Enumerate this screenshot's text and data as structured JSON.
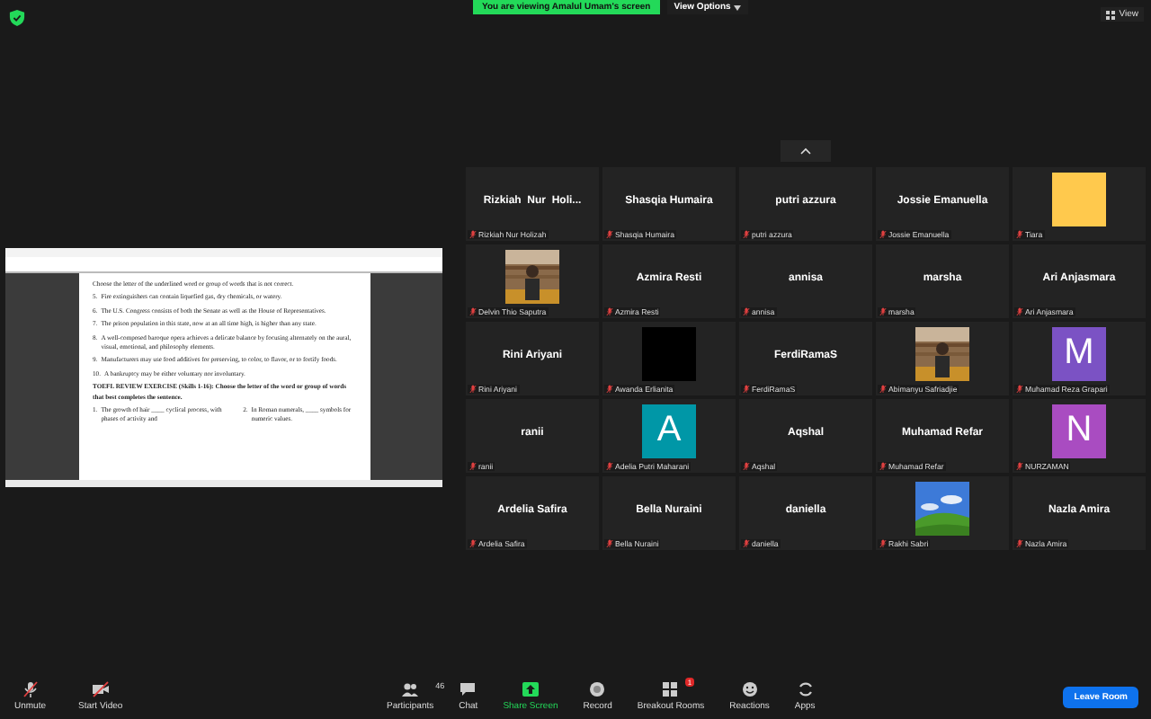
{
  "top_bar": {
    "banner": "You are viewing Amalul Umam's screen",
    "view_options": "View Options",
    "view": "View"
  },
  "shared_document": {
    "instruction": "Choose the letter of the underlined word or group of words that is not correct.",
    "items": [
      {
        "number": "5.",
        "text": "Fire extinguishers can contain liquefied gas, dry chemicals, or watery."
      },
      {
        "number": "6.",
        "text": "The U.S. Congress consists of both the Senate as well as the House of Representatives."
      },
      {
        "number": "7.",
        "text": "The prison population in this state, now at an all time high, is higher than any state."
      },
      {
        "number": "8.",
        "text": "A well-composed baroque opera achieves a delicate balance by focusing alternately on the aural, visual, emotional, and philosophy elements."
      },
      {
        "number": "9.",
        "text": "Manufacturers may use food additives for preserving, to color, to flavor, or to fortify foods."
      },
      {
        "number": "10.",
        "text": "A bankruptcy may be either voluntary nor involuntary."
      }
    ],
    "exercise": "TOEFL REVIEW EXERCISE (Skills 1-16): Choose the letter of the word or group of words that best completes the sentence.",
    "questions": [
      {
        "number": "1.",
        "text": "The growth of hair ____ cyclical process, with phases of activity and"
      },
      {
        "number": "2.",
        "text": "In Roman numerals, ____ symbols for numeric values."
      }
    ]
  },
  "gallery": [
    {
      "kind": "name",
      "title": "Rizkiah  Nur  Holi...",
      "name": "Rizkiah Nur Holizah"
    },
    {
      "kind": "name",
      "title": "Shasqia Humaira",
      "name": "Shasqia Humaira"
    },
    {
      "kind": "name",
      "title": "putri azzura",
      "name": "putri azzura"
    },
    {
      "kind": "name",
      "title": "Jossie Emanuella",
      "name": "Jossie Emanuella"
    },
    {
      "kind": "avatar",
      "color": "#ffc94d",
      "name": "Tiara"
    },
    {
      "kind": "picture",
      "name": "Delvin Thio Saputra"
    },
    {
      "kind": "name",
      "title": "Azmira Resti",
      "name": "Azmira Resti"
    },
    {
      "kind": "name",
      "title": "annisa",
      "name": "annisa"
    },
    {
      "kind": "name",
      "title": "marsha",
      "name": "marsha"
    },
    {
      "kind": "name",
      "title": "Ari Anjasmara",
      "name": "Ari Anjasmara"
    },
    {
      "kind": "name",
      "title": "Rini Ariyani",
      "name": "Rini Ariyani"
    },
    {
      "kind": "avatar",
      "color": "#000000",
      "name": "Awanda Erlianita"
    },
    {
      "kind": "name",
      "title": "FerdiRamaS",
      "name": "FerdiRamaS"
    },
    {
      "kind": "picture",
      "name": "Abimanyu Safriadjie"
    },
    {
      "kind": "avatar",
      "color": "#7b52c4",
      "letter": "M",
      "name": "Muhamad Reza Grapari"
    },
    {
      "kind": "name",
      "title": "ranii",
      "name": "ranii"
    },
    {
      "kind": "avatar",
      "color": "#0097a7",
      "letter": "A",
      "name": "Adelia Putri Maharani"
    },
    {
      "kind": "name",
      "title": "Aqshal",
      "name": "Aqshal"
    },
    {
      "kind": "name",
      "title": "Muhamad Refar",
      "name": "Muhamad Refar"
    },
    {
      "kind": "avatar",
      "color": "#a94cc1",
      "letter": "N",
      "name": "NURZAMAN"
    },
    {
      "kind": "name",
      "title": "Ardelia Safira",
      "name": "Ardelia Safira"
    },
    {
      "kind": "name",
      "title": "Bella Nuraini",
      "name": "Bella Nuraini"
    },
    {
      "kind": "name",
      "title": "daniella",
      "name": "daniella"
    },
    {
      "kind": "picture",
      "name": "Rakhi Sabri"
    },
    {
      "kind": "name",
      "title": "Nazla Amira",
      "name": "Nazla Amira"
    }
  ],
  "toolbar": {
    "buttons": [
      {
        "kind": "mic",
        "label": "Unmute"
      },
      {
        "kind": "video",
        "label": "Start Video"
      }
    ],
    "center": [
      {
        "kind": "participants",
        "label": "Participants",
        "count": "46"
      },
      {
        "kind": "chat",
        "label": "Chat"
      },
      {
        "kind": "share",
        "label": "Share Screen"
      },
      {
        "kind": "record",
        "label": "Record"
      },
      {
        "kind": "breakout",
        "label": "Breakout Rooms",
        "badge": "1"
      },
      {
        "kind": "reactions",
        "label": "Reactions"
      },
      {
        "kind": "apps",
        "label": "Apps"
      }
    ],
    "leave": "Leave Room"
  }
}
